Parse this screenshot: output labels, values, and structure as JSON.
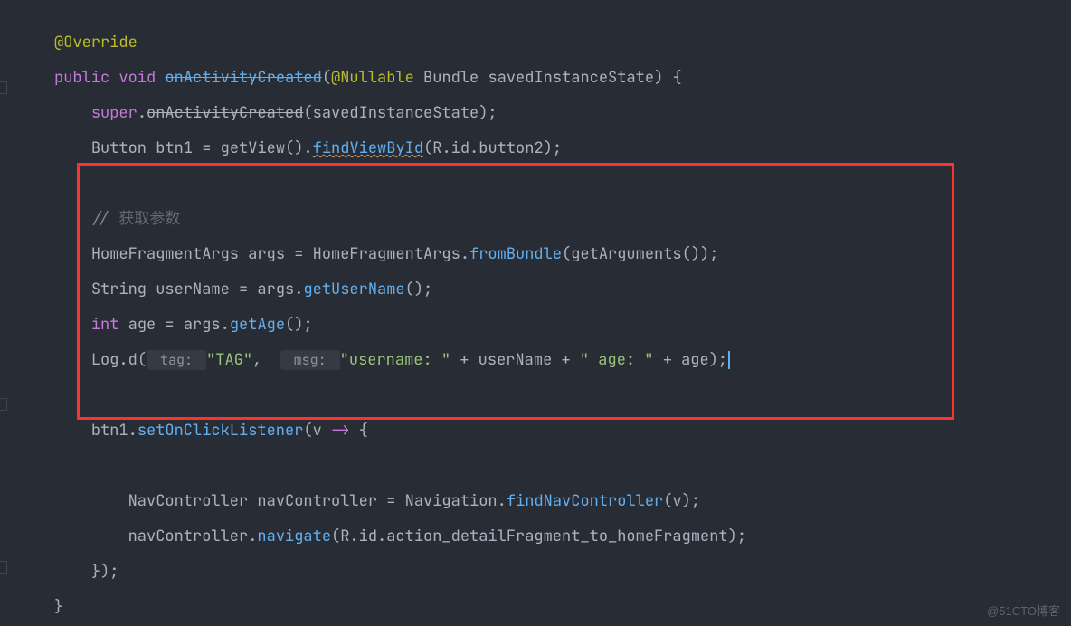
{
  "code": {
    "l1": {
      "annotation": "@Override"
    },
    "l2": {
      "kw_public": "public",
      "kw_void": "void",
      "method": "onActivityCreated",
      "annot": "@Nullable",
      "type": "Bundle",
      "param": "savedInstanceState",
      "brace": ") {"
    },
    "l3": {
      "super": "super",
      "dot": ".",
      "method": "onActivityCreated",
      "args": "(savedInstanceState);"
    },
    "l4": {
      "type": "Button",
      "var": "btn1",
      "eq": " = ",
      "getView": "getView",
      "p1": "().",
      "findViewById": "findViewById",
      "p2": "(R.id.button2);"
    },
    "l5": {
      "comment_slash": "// ",
      "comment_txt": "获取参数"
    },
    "l6": {
      "type": "HomeFragmentArgs",
      "var": "args",
      "eq": " = HomeFragmentArgs.",
      "method": "fromBundle",
      "p1": "(",
      "getArgs": "getArguments",
      "p2": "());"
    },
    "l7": {
      "type": "String",
      "var": "userName",
      "eq": " = args.",
      "method": "getUserName",
      "p": "();"
    },
    "l8": {
      "kw_int": "int",
      "var": "age",
      "eq": " = args.",
      "method": "getAge",
      "p": "();"
    },
    "l9": {
      "log": "Log.",
      "d": "d",
      "p1": "(",
      "hint1": " tag: ",
      "str1": "\"TAG\"",
      "comma": ", ",
      "hint2": " msg: ",
      "str2": "\"username: \"",
      "plus1": " + userName + ",
      "str3": "\" age: \"",
      "plus2": " + age);"
    },
    "l10": {
      "btn": "btn1.",
      "method": "setOnClickListener",
      "p1": "(v ",
      "arrow": "->",
      "p2": " {"
    },
    "l11": {
      "type": "NavController",
      "var": "navController",
      "eq": " = Navigation.",
      "method": "findNavController",
      "p": "(v);"
    },
    "l12": {
      "nav": "navController.",
      "method": "navigate",
      "p": "(R.id.action_detailFragment_to_homeFragment);"
    },
    "l13": {
      "close": "});"
    },
    "l14": {
      "brace": "}"
    }
  },
  "watermark": "@51CTO博客"
}
